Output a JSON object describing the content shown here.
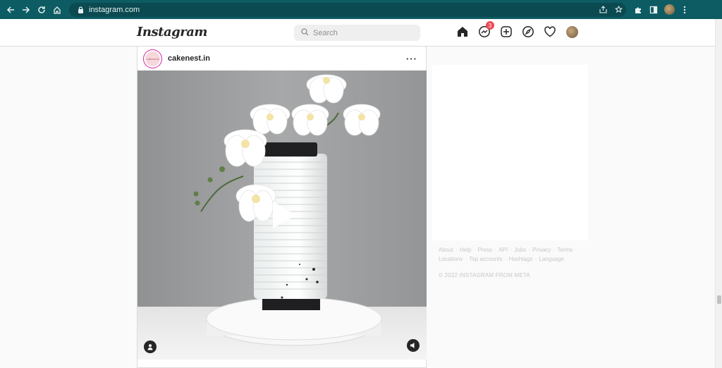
{
  "browser": {
    "url": "instagram.com"
  },
  "header": {
    "logo": "Instagram",
    "search_placeholder": "Search",
    "messages_badge": "3"
  },
  "post": {
    "username": "cakenest.in",
    "avatar_text": "cakenest",
    "more": "···"
  },
  "sidebar": {
    "footer_links": [
      "About",
      "Help",
      "Press",
      "API",
      "Jobs",
      "Privacy",
      "Terms",
      "Locations",
      "Top accounts",
      "Hashtags",
      "Language"
    ],
    "copyright": "© 2022 INSTAGRAM FROM META"
  }
}
